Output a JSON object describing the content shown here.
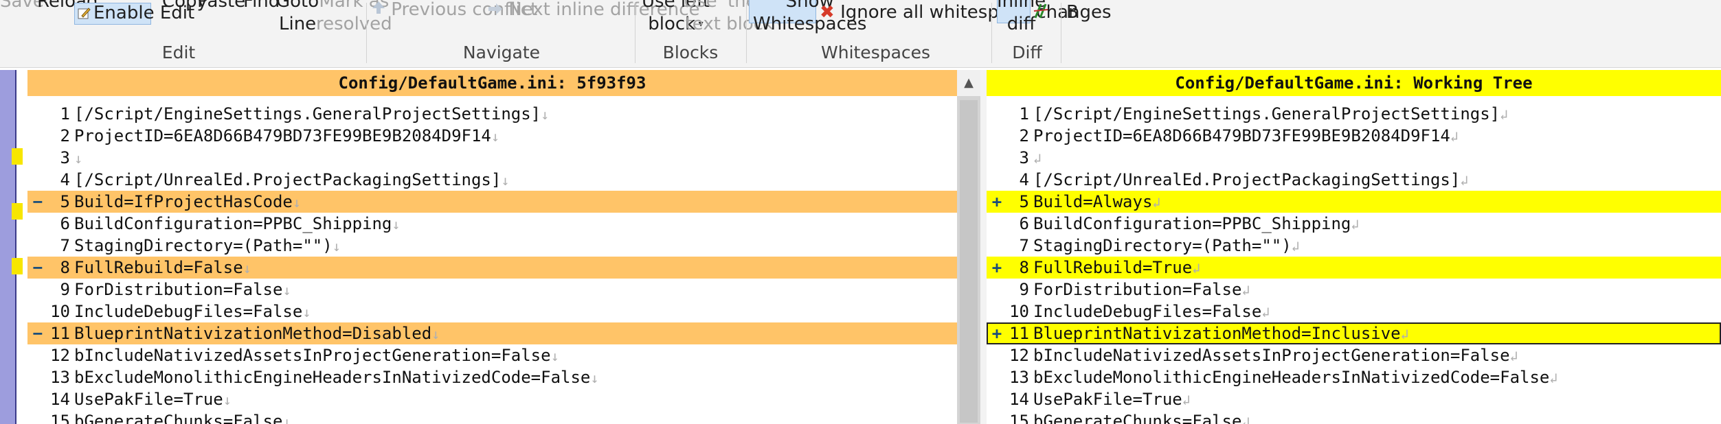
{
  "ribbon": {
    "save": "Save",
    "reload": "Reload",
    "enable_edit": "Enable Edit",
    "copy": "Copy",
    "paste": "Paste",
    "find": "Find",
    "goto_line_1": "Goto",
    "goto_line_2": "Line",
    "mark_resolved_1": "Mark as",
    "mark_resolved_2": "resolved",
    "previous_conflict": "Previous conflict",
    "next_inline_difference": "Next inline difference",
    "use_left_block_1": "Use left",
    "use_left_block_2": "block",
    "use_theirs_1": "Use 'theirs'",
    "use_theirs_2": "text block",
    "show_whitespaces_1": "Show",
    "show_whitespaces_2": "Whitespaces",
    "ignore_whitespace": "Ignore all whitespace changes",
    "inline_diff_1": "Inline",
    "inline_diff_2": "diff",
    "cut_off_b": "B",
    "groups": {
      "edit": "Edit",
      "navigate": "Navigate",
      "blocks": "Blocks",
      "whitespaces": "Whitespaces",
      "diff": "Diff"
    }
  },
  "left_pane": {
    "title": "Config/DefaultGame.ini: 5f93f93",
    "lines": [
      {
        "num": "1",
        "text": "[/Script/EngineSettings.GeneralProjectSettings]",
        "sign": "",
        "changed": false
      },
      {
        "num": "2",
        "text": "ProjectID=6EA8D66B479BD73FE99BE9B2084D9F14",
        "sign": "",
        "changed": false
      },
      {
        "num": "3",
        "text": "",
        "sign": "",
        "changed": false
      },
      {
        "num": "4",
        "text": "[/Script/UnrealEd.ProjectPackagingSettings]",
        "sign": "",
        "changed": false
      },
      {
        "num": "5",
        "text": "Build=IfProjectHasCode",
        "sign": "−",
        "changed": true
      },
      {
        "num": "6",
        "text": "BuildConfiguration=PPBC_Shipping",
        "sign": "",
        "changed": false
      },
      {
        "num": "7",
        "text": "StagingDirectory=(Path=\"\")",
        "sign": "",
        "changed": false
      },
      {
        "num": "8",
        "text": "FullRebuild=False",
        "sign": "−",
        "changed": true
      },
      {
        "num": "9",
        "text": "ForDistribution=False",
        "sign": "",
        "changed": false
      },
      {
        "num": "10",
        "text": "IncludeDebugFiles=False",
        "sign": "",
        "changed": false
      },
      {
        "num": "11",
        "text": "BlueprintNativizationMethod=Disabled",
        "sign": "−",
        "changed": true
      },
      {
        "num": "12",
        "text": "bIncludeNativizedAssetsInProjectGeneration=False",
        "sign": "",
        "changed": false
      },
      {
        "num": "13",
        "text": "bExcludeMonolithicEngineHeadersInNativizedCode=False",
        "sign": "",
        "changed": false
      },
      {
        "num": "14",
        "text": "UsePakFile=True",
        "sign": "",
        "changed": false
      },
      {
        "num": "15",
        "text": "bGenerateChunks=False",
        "sign": "",
        "changed": false
      }
    ]
  },
  "right_pane": {
    "title": "Config/DefaultGame.ini: Working Tree",
    "lines": [
      {
        "num": "1",
        "text": "[/Script/EngineSettings.GeneralProjectSettings]",
        "sign": "",
        "changed": false
      },
      {
        "num": "2",
        "text": "ProjectID=6EA8D66B479BD73FE99BE9B2084D9F14",
        "sign": "",
        "changed": false
      },
      {
        "num": "3",
        "text": "",
        "sign": "",
        "changed": false
      },
      {
        "num": "4",
        "text": "[/Script/UnrealEd.ProjectPackagingSettings]",
        "sign": "",
        "changed": false
      },
      {
        "num": "5",
        "text": "Build=Always",
        "sign": "+",
        "changed": true
      },
      {
        "num": "6",
        "text": "BuildConfiguration=PPBC_Shipping",
        "sign": "",
        "changed": false
      },
      {
        "num": "7",
        "text": "StagingDirectory=(Path=\"\")",
        "sign": "",
        "changed": false
      },
      {
        "num": "8",
        "text": "FullRebuild=True",
        "sign": "+",
        "changed": true
      },
      {
        "num": "9",
        "text": "ForDistribution=False",
        "sign": "",
        "changed": false
      },
      {
        "num": "10",
        "text": "IncludeDebugFiles=False",
        "sign": "",
        "changed": false
      },
      {
        "num": "11",
        "text": "BlueprintNativizationMethod=Inclusive",
        "sign": "+",
        "changed": true,
        "current": true
      },
      {
        "num": "12",
        "text": "bIncludeNativizedAssetsInProjectGeneration=False",
        "sign": "",
        "changed": false
      },
      {
        "num": "13",
        "text": "bExcludeMonolithicEngineHeadersInNativizedCode=False",
        "sign": "",
        "changed": false
      },
      {
        "num": "14",
        "text": "UsePakFile=True",
        "sign": "",
        "changed": false
      },
      {
        "num": "15",
        "text": "bGenerateChunks=False",
        "sign": "",
        "changed": false
      }
    ]
  },
  "colors": {
    "left_changed": "#ffc468",
    "right_changed": "#ffff00",
    "gutter": "#9d9ddd"
  },
  "icons": {
    "eol_left": "↓",
    "eol_right": "↲",
    "previous_conflict": "up-arrow-icon",
    "next_inline_difference": "right-arrow-icon",
    "ignore_whitespace": "x-icon",
    "enable_edit": "edit-icon"
  }
}
